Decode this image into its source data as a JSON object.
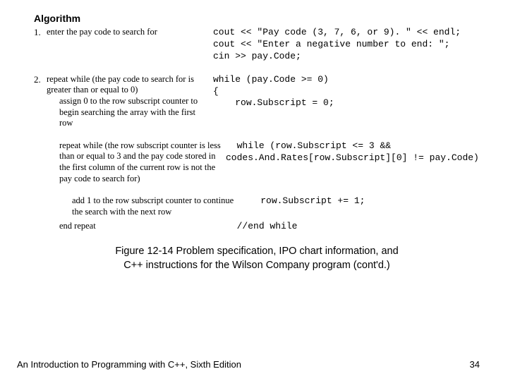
{
  "heading": "Algorithm",
  "step1": {
    "num": "1.",
    "algo": "enter the pay code to search for",
    "code": "cout << \"Pay code (3, 7, 6, or 9). \" << endl;\ncout << \"Enter a negative number to end: \";\ncin >> pay.Code;"
  },
  "step2": {
    "num": "2.",
    "algo_head": "repeat while (the pay code to search for is greater than or equal to 0)",
    "algo_sub1": "assign 0 to the row subscript counter to begin searching the array with the first row",
    "code_head": "while (pay.Code >= 0)\n{\n    row.Subscript = 0;",
    "algo_inner": "repeat while (the row subscript counter is less than or equal to 3 and the pay code stored in the first column of the current row is not the pay code to search for)",
    "code_inner": "  while (row.Subscript <= 3 && codes.And.Rates[row.Subscript][0] != pay.Code)",
    "algo_incr": "add 1 to the row subscript counter to continue the search with the next row",
    "code_incr": "    row.Subscript += 1;",
    "algo_end": "end repeat",
    "code_end": "  //end while"
  },
  "caption_line1": "Figure 12-14 Problem specification, IPO chart information, and",
  "caption_line2": "C++ instructions for the Wilson Company program (cont'd.)",
  "footer_left": "An Introduction to Programming with C++, Sixth Edition",
  "footer_right": "34"
}
